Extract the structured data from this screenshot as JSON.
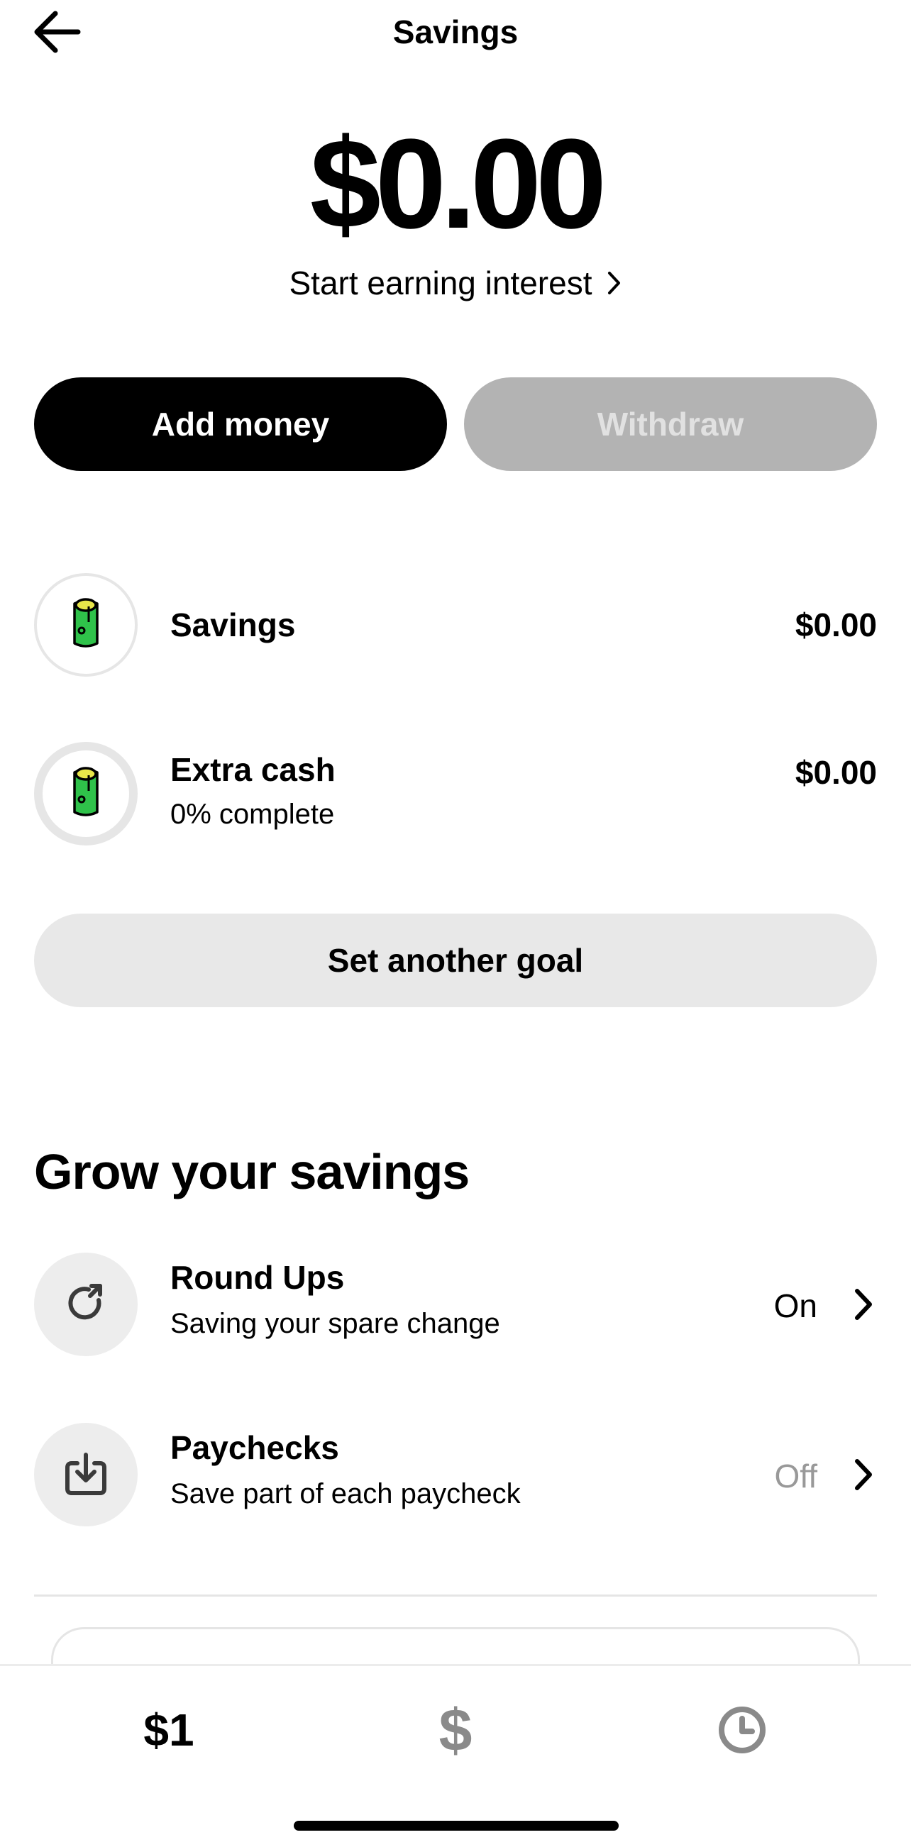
{
  "header": {
    "title": "Savings",
    "back_icon": "arrow-left-icon"
  },
  "balance": {
    "amount": "$0.00",
    "interest_link": "Start earning interest"
  },
  "actions": {
    "add_money": "Add money",
    "withdraw": "Withdraw"
  },
  "accounts": [
    {
      "name": "Savings",
      "subtitle": "",
      "amount": "$0.00",
      "icon": "cash-roll-icon"
    },
    {
      "name": "Extra cash",
      "subtitle": "0% complete",
      "amount": "$0.00",
      "icon": "cash-roll-icon",
      "progress": 0
    }
  ],
  "set_goal_label": "Set another goal",
  "grow": {
    "title": "Grow your savings",
    "items": [
      {
        "title": "Round Ups",
        "subtitle": "Saving your spare change",
        "status": "On",
        "icon": "round-up-icon"
      },
      {
        "title": "Paychecks",
        "subtitle": "Save part of each paycheck",
        "status": "Off",
        "icon": "paycheck-deposit-icon"
      }
    ]
  },
  "nav": {
    "banking_label": "$1",
    "cash_label": "$",
    "activity_icon": "clock-icon"
  },
  "colors": {
    "primary": "#000000",
    "disabled_button": "#b3b3b3",
    "secondary_button": "#e8e8e8",
    "cash_green": "#2fc24a",
    "cash_yellow": "#e8e64a"
  }
}
